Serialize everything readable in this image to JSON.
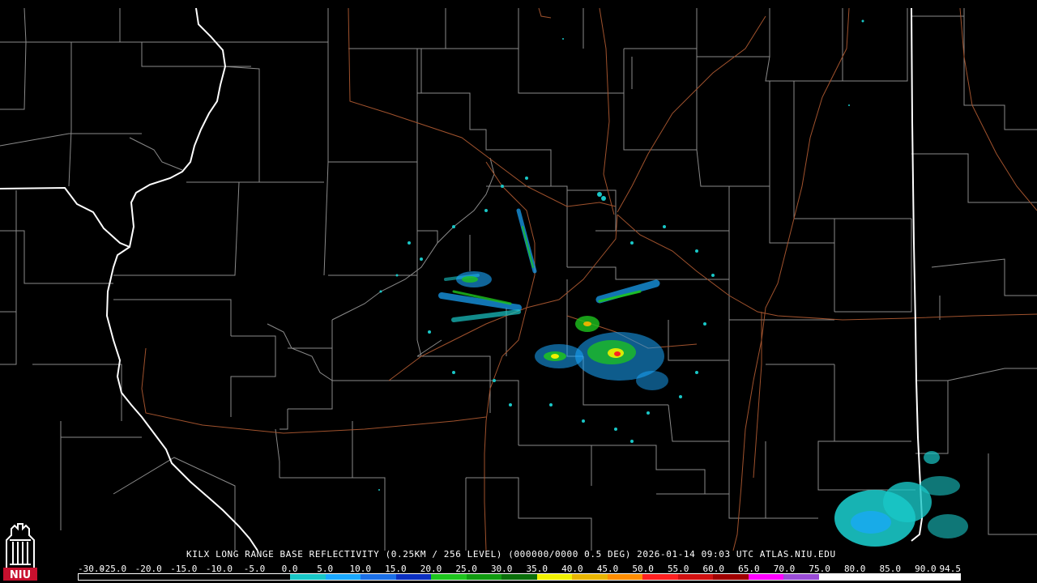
{
  "product": {
    "caption": "KILX LONG RANGE BASE REFLECTIVITY (0.25KM / 256 LEVEL) (000000/0000 0.5 DEG) 2026-01-14 09:03 UTC  ATLAS.NIU.EDU"
  },
  "scale": {
    "labels": [
      "-30.0",
      "-25.0",
      "-20.0",
      "-15.0",
      "-10.0",
      "-5.0",
      "0.0",
      "5.0",
      "10.0",
      "15.0",
      "20.0",
      "25.0",
      "30.0",
      "35.0",
      "40.0",
      "45.0",
      "50.0",
      "55.0",
      "60.0",
      "65.0",
      "70.0",
      "75.0",
      "80.0",
      "85.0",
      "90.0",
      "94.5"
    ],
    "colors": [
      "#000000",
      "#000000",
      "#000000",
      "#000000",
      "#000000",
      "#000000",
      "#19c7c7",
      "#1aa8ff",
      "#1b6fe6",
      "#0b2fc0",
      "#1ec41e",
      "#109a10",
      "#0a6e0a",
      "#f0f000",
      "#e8b400",
      "#ff8c00",
      "#ff2020",
      "#d01010",
      "#a00000",
      "#ff00ff",
      "#9a4cd6",
      "#ffffff",
      "#ffffff",
      "#ffffff",
      "#ffffff"
    ]
  },
  "map": {
    "colors": {
      "background": "#000000",
      "county_lines": "#8a8a8a",
      "state_lines": "#ffffff",
      "highways": "#a0522d"
    },
    "radar_site": "KILX"
  },
  "logo": {
    "label": "NIU",
    "icon": "niu-tower-logo",
    "color": "#c8102e"
  }
}
